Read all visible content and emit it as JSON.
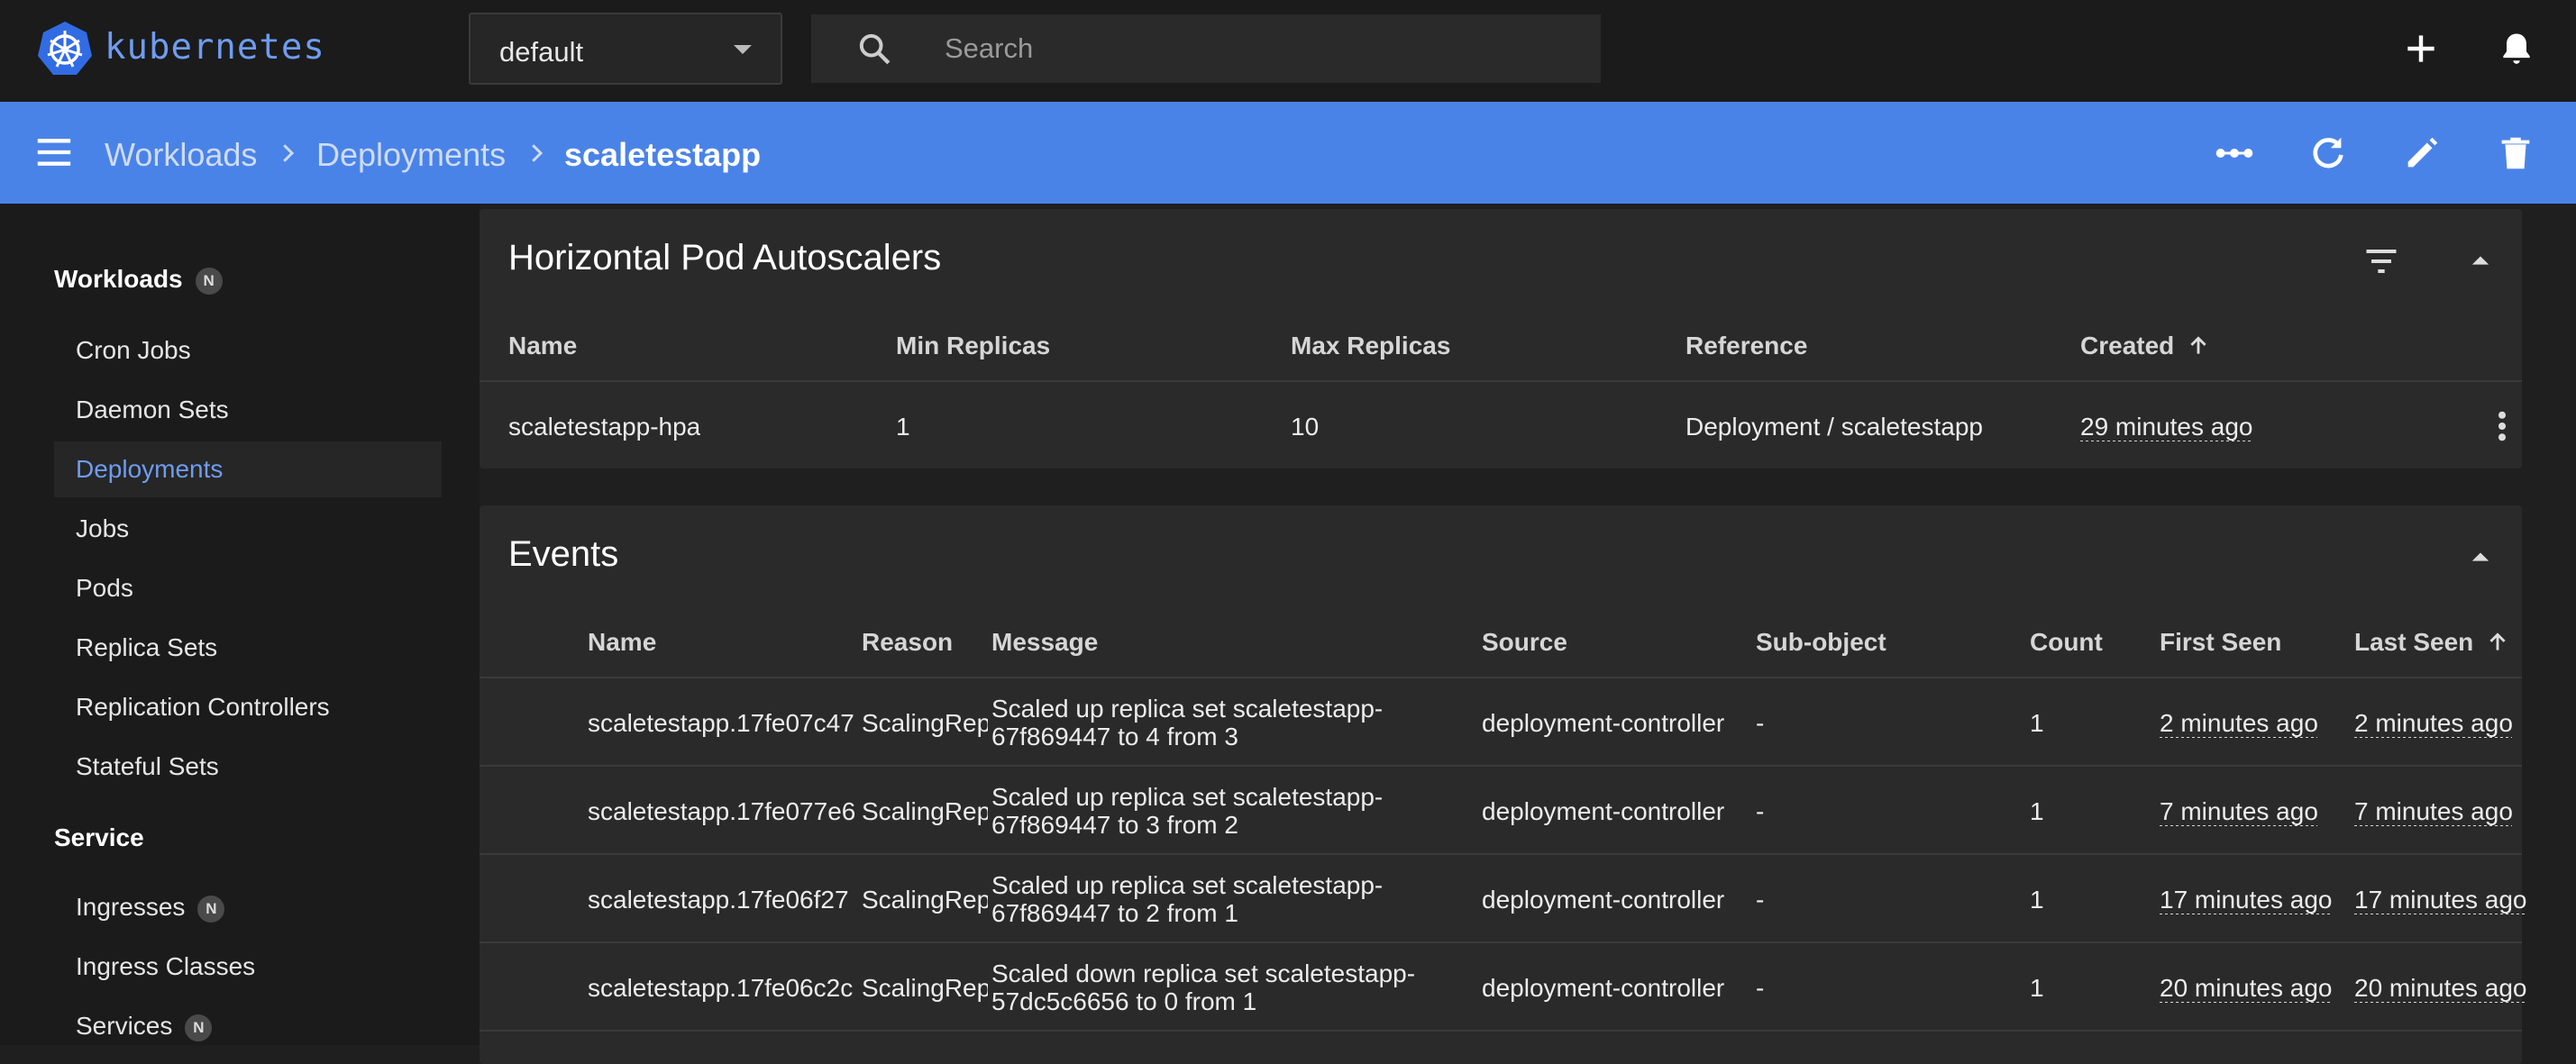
{
  "app": {
    "logo_text": "kubernetes"
  },
  "namespace": {
    "value": "default"
  },
  "search": {
    "placeholder": "Search"
  },
  "breadcrumb": {
    "items": [
      "Workloads",
      "Deployments"
    ],
    "current": "scaletestapp"
  },
  "sidebar": {
    "workloads_label": "Workloads",
    "workloads_badge": "N",
    "workload_items": [
      "Cron Jobs",
      "Daemon Sets",
      "Deployments",
      "Jobs",
      "Pods",
      "Replica Sets",
      "Replication Controllers",
      "Stateful Sets"
    ],
    "active_item": "Deployments",
    "service_label": "Service",
    "service_items": [
      {
        "label": "Ingresses",
        "badge": "N"
      },
      {
        "label": "Ingress Classes",
        "badge": ""
      },
      {
        "label": "Services",
        "badge": "N"
      }
    ]
  },
  "hpa": {
    "title": "Horizontal Pod Autoscalers",
    "columns": [
      "Name",
      "Min Replicas",
      "Max Replicas",
      "Reference",
      "Created"
    ],
    "rows": [
      {
        "name": "scaletestapp-hpa",
        "min": "1",
        "max": "10",
        "reference": "Deployment / scaletestapp",
        "created": "29 minutes ago"
      }
    ]
  },
  "events": {
    "title": "Events",
    "columns": [
      "Name",
      "Reason",
      "Message",
      "Source",
      "Sub-object",
      "Count",
      "First Seen",
      "Last Seen"
    ],
    "rows": [
      {
        "name": "scaletestapp.17fe07c47",
        "reason": "ScalingReplicaSet",
        "message": "Scaled up replica set scaletestapp-67f869447 to 4 from 3",
        "source": "deployment-controller",
        "subobject": "-",
        "count": "1",
        "first": "2 minutes ago",
        "last": "2 minutes ago"
      },
      {
        "name": "scaletestapp.17fe077e6",
        "reason": "ScalingReplicaSet",
        "message": "Scaled up replica set scaletestapp-67f869447 to 3 from 2",
        "source": "deployment-controller",
        "subobject": "-",
        "count": "1",
        "first": "7 minutes ago",
        "last": "7 minutes ago"
      },
      {
        "name": "scaletestapp.17fe06f27",
        "reason": "ScalingReplicaSet",
        "message": "Scaled up replica set scaletestapp-67f869447 to 2 from 1",
        "source": "deployment-controller",
        "subobject": "-",
        "count": "1",
        "first": "17 minutes ago",
        "last": "17 minutes ago"
      },
      {
        "name": "scaletestapp.17fe06c2c",
        "reason": "ScalingReplicaSet",
        "message": "Scaled down replica set scaletestapp-57dc5c6656 to 0 from 1",
        "source": "deployment-controller",
        "subobject": "-",
        "count": "1",
        "first": "20 minutes ago",
        "last": "20 minutes ago"
      }
    ]
  },
  "colors": {
    "accent": "#4a83e8",
    "topbar": "#1b1b1b",
    "link": "#6f9cf0"
  }
}
